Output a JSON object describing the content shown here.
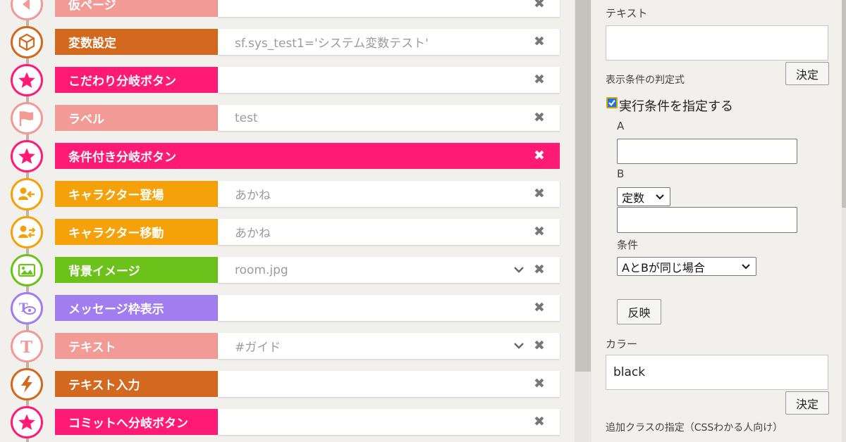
{
  "tags": [
    {
      "label": "仮ページ",
      "value": "",
      "color": "#f29a96",
      "icon": "back-arrow-icon",
      "has_chevron": false
    },
    {
      "label": "変数設定",
      "value": "sf.sys_test1='システム変数テスト'",
      "color": "#d2691e",
      "icon": "cube-icon",
      "has_chevron": false
    },
    {
      "label": "こだわり分岐ボタン",
      "value": "",
      "color": "#ff1a75",
      "icon": "star-icon",
      "has_chevron": false
    },
    {
      "label": "ラベル",
      "value": "test",
      "color": "#f29a96",
      "icon": "flag-icon",
      "has_chevron": false
    },
    {
      "label": "条件付き分岐ボタン",
      "value": "",
      "color": "#ff1a75",
      "icon": "star-icon",
      "has_chevron": false,
      "selected": true
    },
    {
      "label": "キャラクター登場",
      "value": "あかね",
      "color": "#f5a20a",
      "icon": "character-enter-icon",
      "has_chevron": false
    },
    {
      "label": "キャラクター移動",
      "value": "あかね",
      "color": "#f5a20a",
      "icon": "character-move-icon",
      "has_chevron": false
    },
    {
      "label": "背景イメージ",
      "value": "room.jpg",
      "color": "#6cc21a",
      "icon": "image-icon",
      "has_chevron": true
    },
    {
      "label": "メッセージ枠表示",
      "value": "",
      "color": "#a07ef0",
      "icon": "eye-text-icon",
      "has_chevron": false
    },
    {
      "label": "テキスト",
      "value": "#ガイド",
      "color": "#f29a96",
      "icon": "text-t-icon",
      "has_chevron": true
    },
    {
      "label": "テキスト入力",
      "value": "",
      "color": "#d2691e",
      "icon": "lightning-icon",
      "has_chevron": false
    },
    {
      "label": "コミットへ分岐ボタン",
      "value": "",
      "color": "#ff1a75",
      "icon": "star-icon",
      "has_chevron": false
    }
  ],
  "delete_glyph": "✖",
  "panel": {
    "text_label": "テキスト",
    "text_value": "",
    "decide_label": "決定",
    "display_condition_label": "表示条件の判定式",
    "exec_condition_checkbox_label": "実行条件を指定する",
    "exec_condition_checked": true,
    "a_label": "A",
    "a_value": "",
    "b_label": "B",
    "b_type_value": "定数",
    "b_value": "",
    "condition_label": "条件",
    "condition_value": "AとBが同じ場合",
    "apply_label": "反映",
    "color_label": "カラー",
    "color_value": "black",
    "color_decide_label": "決定",
    "extra_class_label": "追加クラスの指定（CSSわかる人向け）"
  }
}
